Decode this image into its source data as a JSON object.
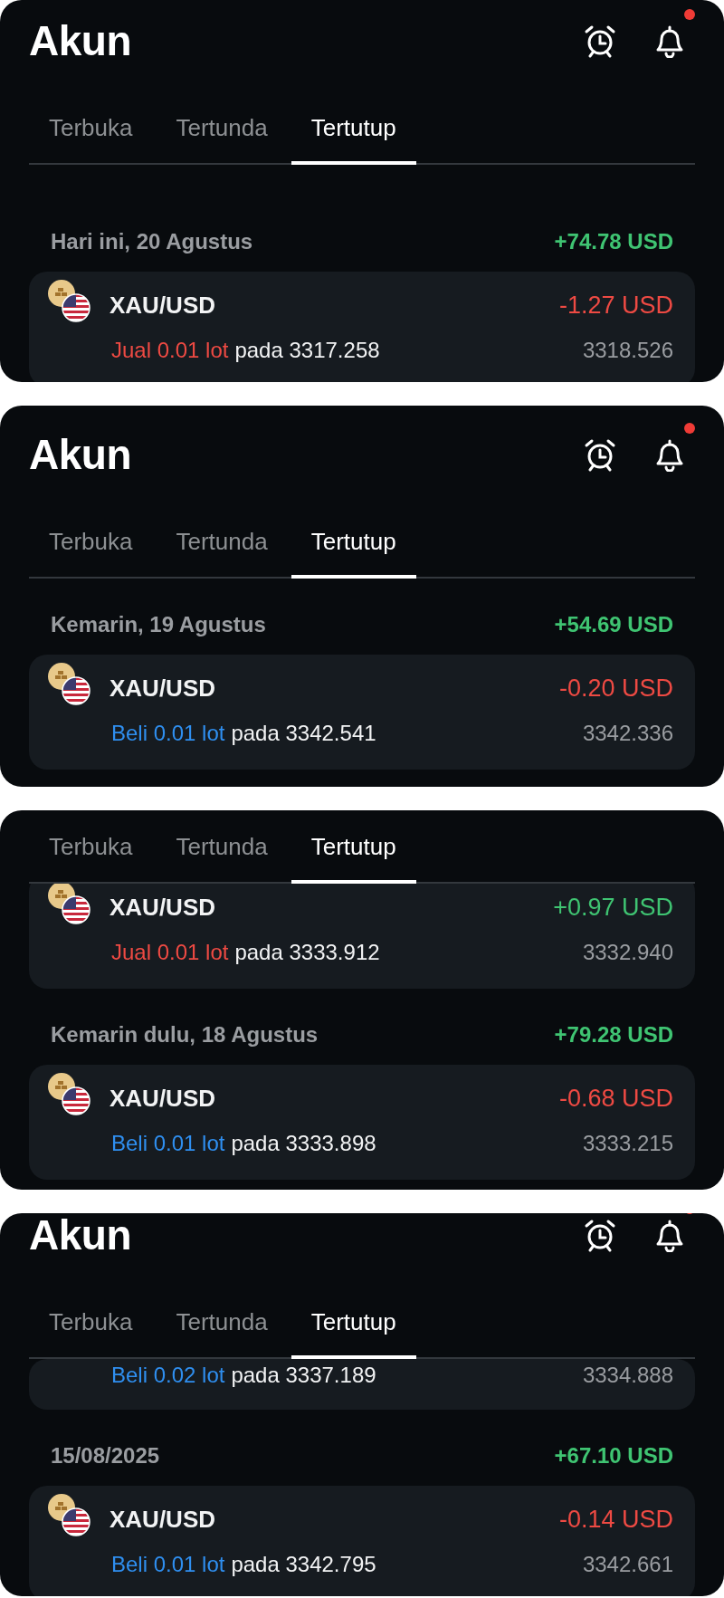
{
  "screens": [
    {
      "title": "Akun",
      "notification_dot": true,
      "tabs": [
        {
          "label": "Terbuka",
          "selected": false
        },
        {
          "label": "Tertunda",
          "selected": false
        },
        {
          "label": "Tertutup",
          "selected": true
        }
      ],
      "feed": [
        {
          "kind": "group",
          "date": "Hari ini, 20 Agustus",
          "total": "+74.78 USD"
        },
        {
          "kind": "trade",
          "pair": "XAU/USD",
          "profit": false,
          "amount": "-1.27 USD",
          "buy": false,
          "order": "Jual 0.01 lot",
          "price": "pada 3317.258",
          "close": "3318.526"
        }
      ]
    },
    {
      "title": "Akun",
      "notification_dot": true,
      "tabs": [
        {
          "label": "Terbuka",
          "selected": false
        },
        {
          "label": "Tertunda",
          "selected": false
        },
        {
          "label": "Tertutup",
          "selected": true
        }
      ],
      "feed": [
        {
          "kind": "group",
          "date": "Kemarin, 19 Agustus",
          "total": "+54.69 USD"
        },
        {
          "kind": "trade",
          "pair": "XAU/USD",
          "profit": false,
          "amount": "-0.20 USD",
          "buy": true,
          "order": "Beli 0.01 lot",
          "price": "pada 3342.541",
          "close": "3342.336"
        }
      ]
    },
    {
      "tabs": [
        {
          "label": "Terbuka",
          "selected": false
        },
        {
          "label": "Tertunda",
          "selected": false
        },
        {
          "label": "Tertutup",
          "selected": true
        }
      ],
      "feed": [
        {
          "kind": "trade",
          "pair": "XAU/USD",
          "profit": true,
          "amount": "+0.97 USD",
          "buy": false,
          "order": "Jual 0.01 lot",
          "price": "pada 3333.912",
          "close": "3332.940"
        },
        {
          "kind": "group",
          "date": "Kemarin dulu, 18 Agustus",
          "total": "+79.28 USD"
        },
        {
          "kind": "trade",
          "pair": "XAU/USD",
          "profit": false,
          "amount": "-0.68 USD",
          "buy": true,
          "order": "Beli 0.01 lot",
          "price": "pada 3333.898",
          "close": "3333.215"
        }
      ]
    },
    {
      "title": "Akun",
      "notification_dot": true,
      "tabs": [
        {
          "label": "Terbuka",
          "selected": false
        },
        {
          "label": "Tertunda",
          "selected": false
        },
        {
          "label": "Tertutup",
          "selected": true
        }
      ],
      "feed": [
        {
          "kind": "trade",
          "buy": true,
          "order": "Beli 0.02 lot",
          "price": "pada 3337.189",
          "close": "3334.888"
        },
        {
          "kind": "group",
          "date": "15/08/2025",
          "total": "+67.10 USD"
        },
        {
          "kind": "trade",
          "pair": "XAU/USD",
          "profit": false,
          "amount": "-0.14 USD",
          "buy": true,
          "order": "Beli 0.01 lot",
          "price": "pada 3342.795",
          "close": "3342.661"
        }
      ]
    }
  ]
}
